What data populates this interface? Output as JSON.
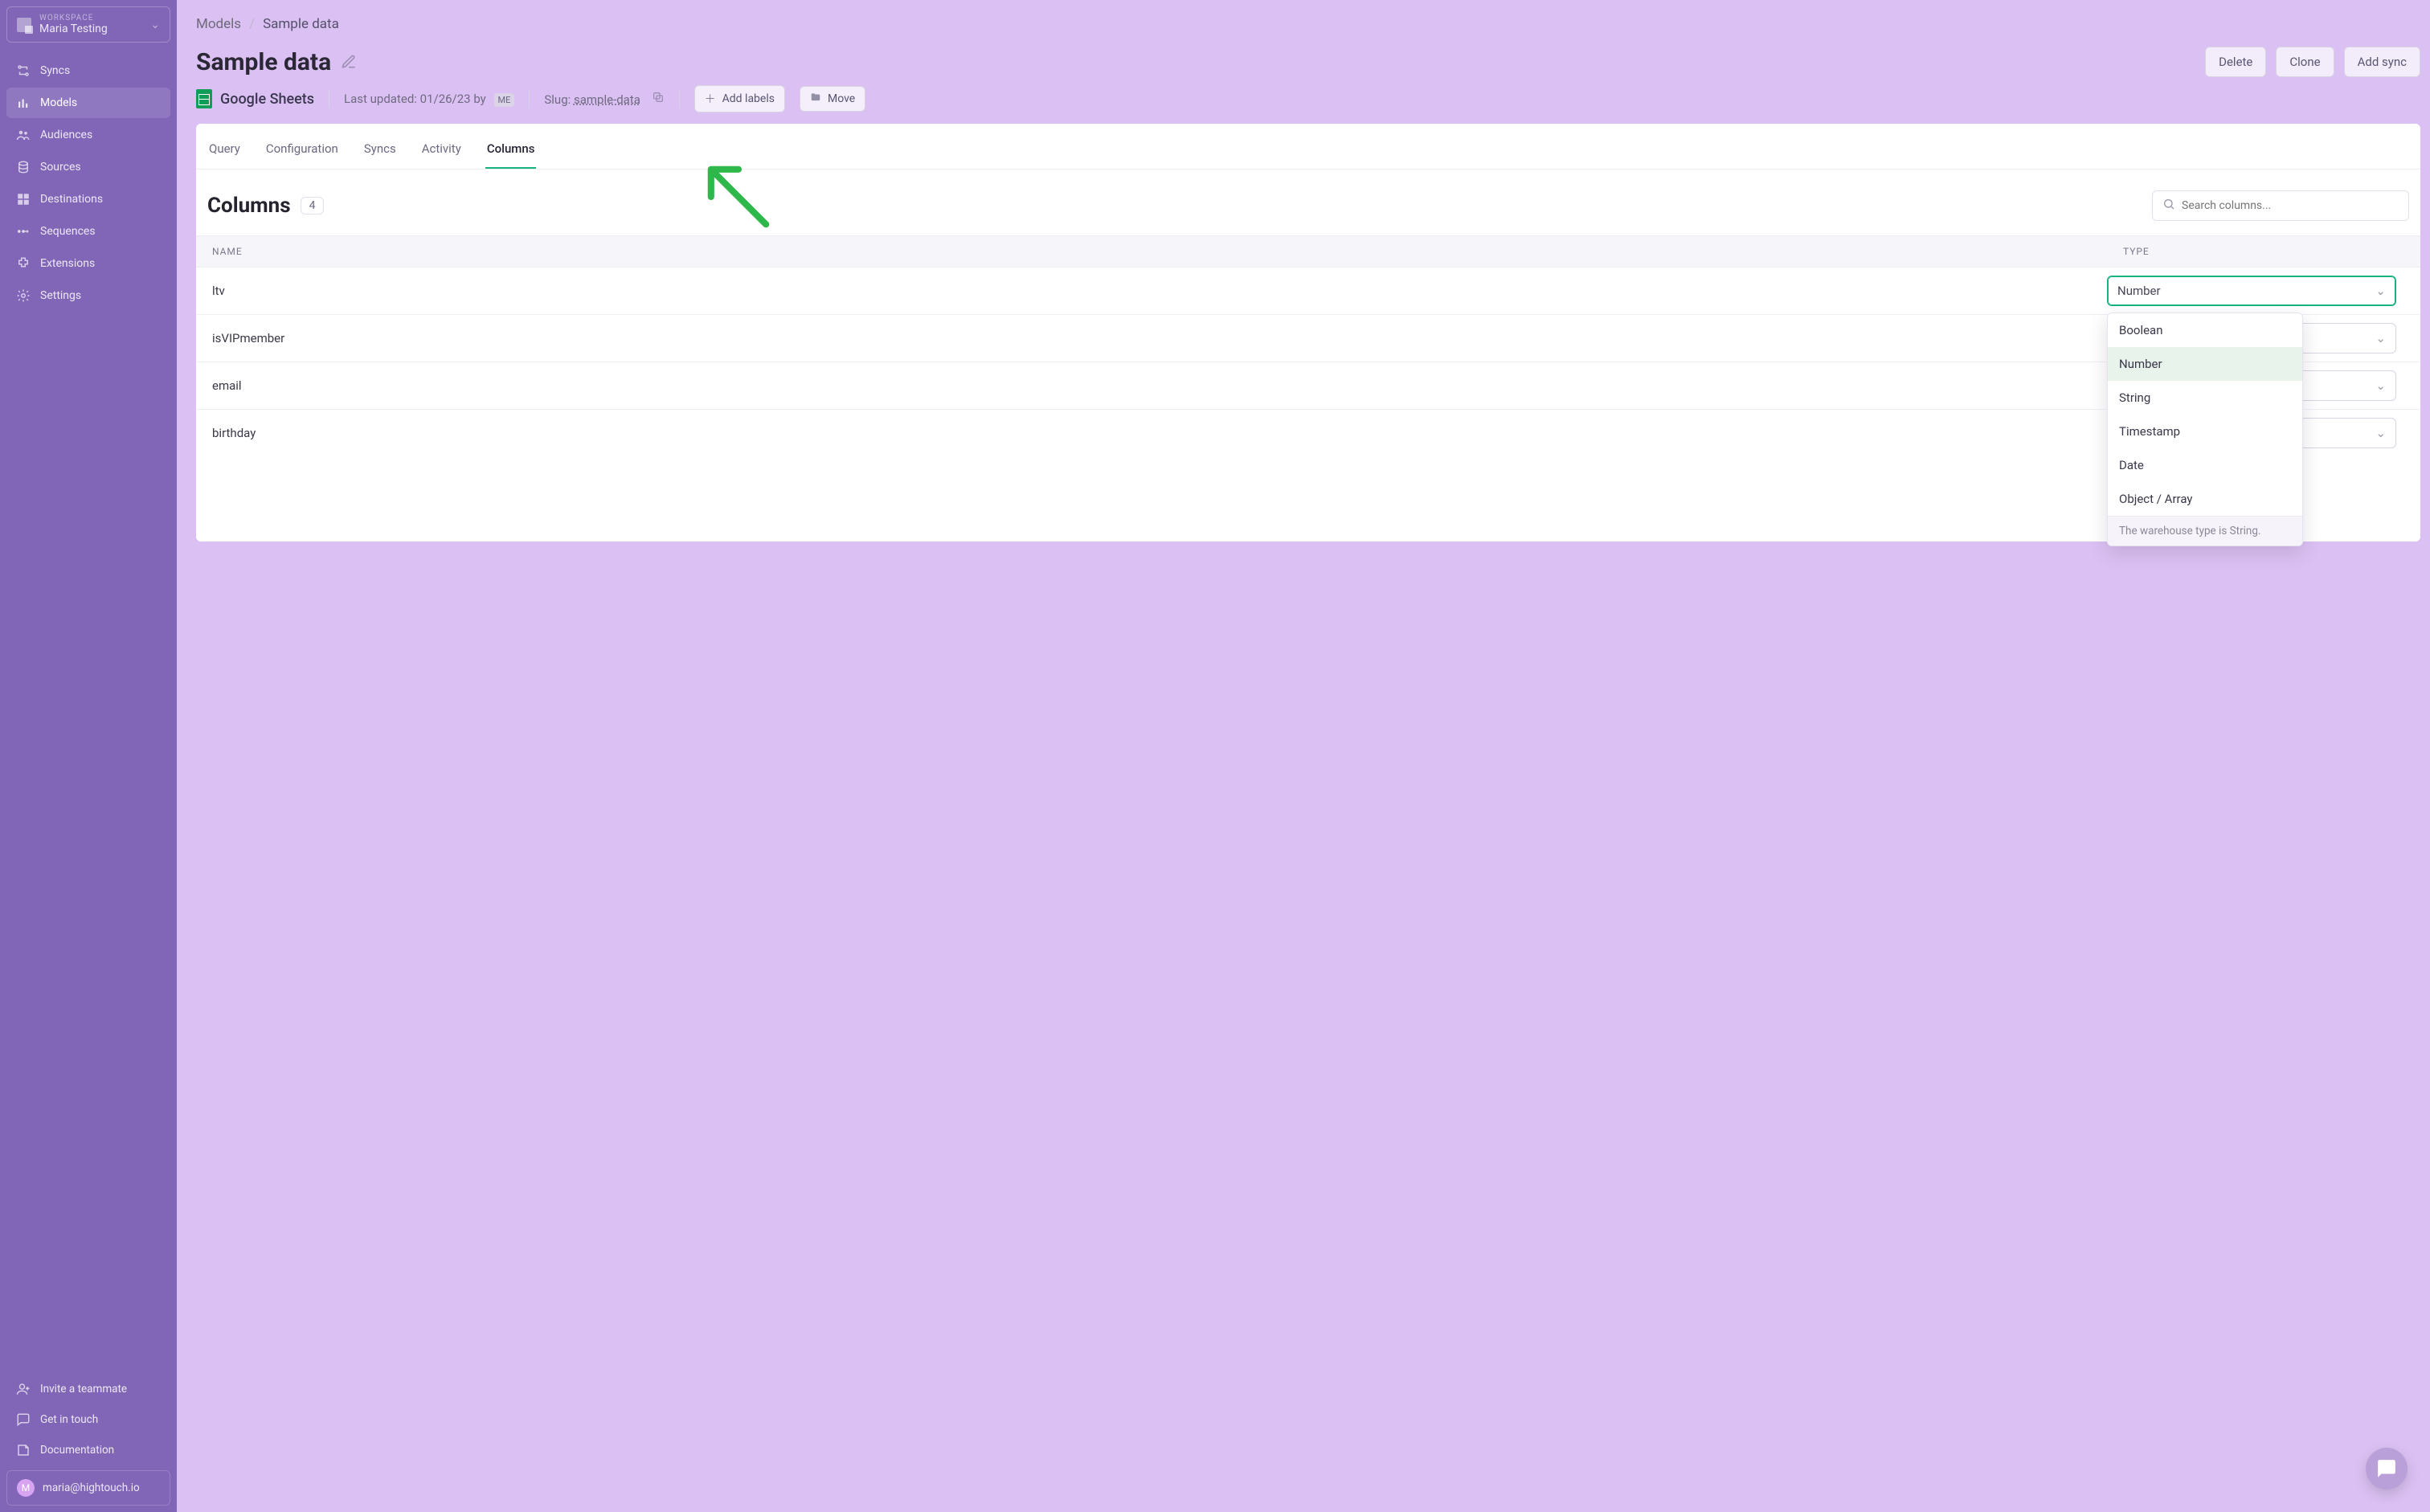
{
  "workspace": {
    "eyebrow": "WORKSPACE",
    "name": "Maria Testing"
  },
  "nav": {
    "items": [
      {
        "label": "Syncs",
        "icon": "syncs"
      },
      {
        "label": "Models",
        "icon": "models",
        "active": true
      },
      {
        "label": "Audiences",
        "icon": "audiences"
      },
      {
        "label": "Sources",
        "icon": "sources"
      },
      {
        "label": "Destinations",
        "icon": "destinations"
      },
      {
        "label": "Sequences",
        "icon": "sequences"
      },
      {
        "label": "Extensions",
        "icon": "extensions"
      },
      {
        "label": "Settings",
        "icon": "settings"
      }
    ],
    "bottom": [
      {
        "label": "Invite a teammate",
        "icon": "invite"
      },
      {
        "label": "Get in touch",
        "icon": "touch"
      },
      {
        "label": "Documentation",
        "icon": "docs"
      }
    ]
  },
  "user": {
    "initial": "M",
    "email": "maria@hightouch.io"
  },
  "breadcrumbs": {
    "root": "Models",
    "current": "Sample data"
  },
  "page": {
    "title": "Sample data",
    "actions": {
      "delete": "Delete",
      "clone": "Clone",
      "addSync": "Add sync"
    },
    "source_name": "Google Sheets",
    "last_updated_prefix": "Last updated: ",
    "last_updated_date": "01/26/23",
    "last_updated_by_word": " by",
    "last_updated_badge": "ME",
    "slug_label": "Slug: ",
    "slug_value": "sample-data",
    "add_labels": "Add labels",
    "move": "Move"
  },
  "tabs": [
    "Query",
    "Configuration",
    "Syncs",
    "Activity",
    "Columns"
  ],
  "tabs_active": "Columns",
  "columns_section": {
    "heading": "Columns",
    "count": "4",
    "search_placeholder": "Search columns...",
    "table": {
      "headers": {
        "name": "NAME",
        "type": "TYPE"
      },
      "rows": [
        {
          "name": "ltv",
          "type": "Number",
          "open": true
        },
        {
          "name": "isVIPmember",
          "type": ""
        },
        {
          "name": "email",
          "type": ""
        },
        {
          "name": "birthday",
          "type": ""
        }
      ]
    }
  },
  "type_dropdown": {
    "options": [
      "Boolean",
      "Number",
      "String",
      "Timestamp",
      "Date",
      "Object / Array"
    ],
    "selected": "Number",
    "footer": "The warehouse type is String."
  }
}
